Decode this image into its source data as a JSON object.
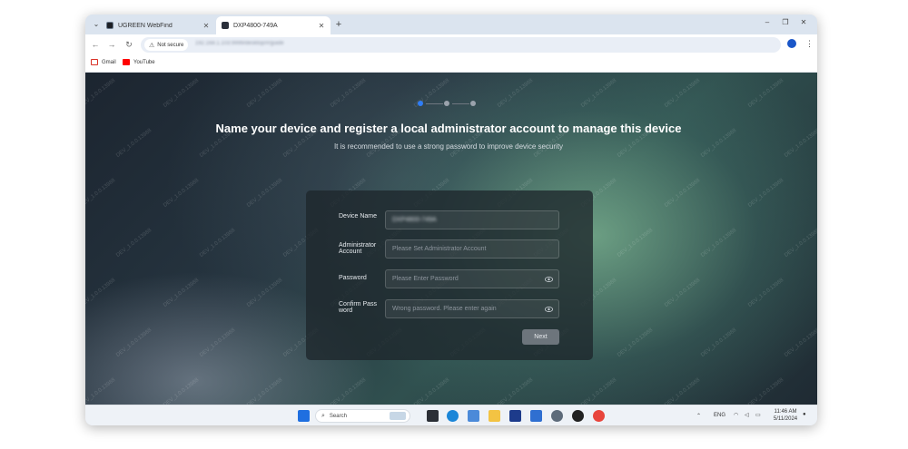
{
  "browser": {
    "tabs": [
      {
        "title": "UGREEN WebFind",
        "active": false
      },
      {
        "title": "DXP4800-749A",
        "active": true
      }
    ],
    "address_bar": {
      "security_label": "Not secure",
      "url": "192.168.1.103:9999/desktop/#/guide"
    },
    "bookmarks": [
      {
        "label": "Gmail",
        "icon": "gmail-icon"
      },
      {
        "label": "YouTube",
        "icon": "youtube-icon"
      }
    ]
  },
  "setup": {
    "current_step": 1,
    "total_steps": 3,
    "title": "Name your device and register a local administrator account to manage this device",
    "subtitle": "It is recommended to use a strong password to improve device security",
    "watermark_text": "DEV_1.0.0.13988",
    "fields": {
      "device_name": {
        "label": "Device Name",
        "value": "DXP4800-749A",
        "placeholder": ""
      },
      "admin_account": {
        "label": "Administrator Account",
        "value": "",
        "placeholder": "Please Set Administrator Account"
      },
      "password": {
        "label": "Password",
        "value": "",
        "placeholder": "Please Enter Password"
      },
      "confirm_password": {
        "label": "Confirm Password",
        "value": "",
        "placeholder": "Wrong password. Please enter again"
      }
    },
    "next_label": "Next"
  },
  "taskbar": {
    "search_label": "Search",
    "language": "ENG",
    "time": "11:46 AM",
    "date": "5/11/2024"
  },
  "colors": {
    "step_active": "#2f7df6",
    "next_button": "#6d757c"
  }
}
